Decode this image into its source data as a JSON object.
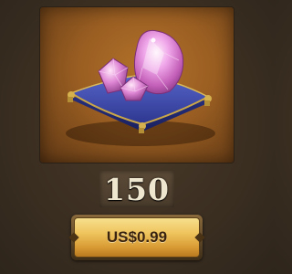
{
  "item": {
    "icon": "gem-pile-on-cushion-icon",
    "quantity": "150"
  },
  "purchase": {
    "price_label": "US$0.99"
  },
  "colors": {
    "background": "#3a2e21",
    "art_background": "#9a5e22",
    "gem": "#e9a2e6",
    "cushion": "#3b47a8",
    "button_gold": "#eec35c",
    "quantity_text": "#efe6cf"
  }
}
